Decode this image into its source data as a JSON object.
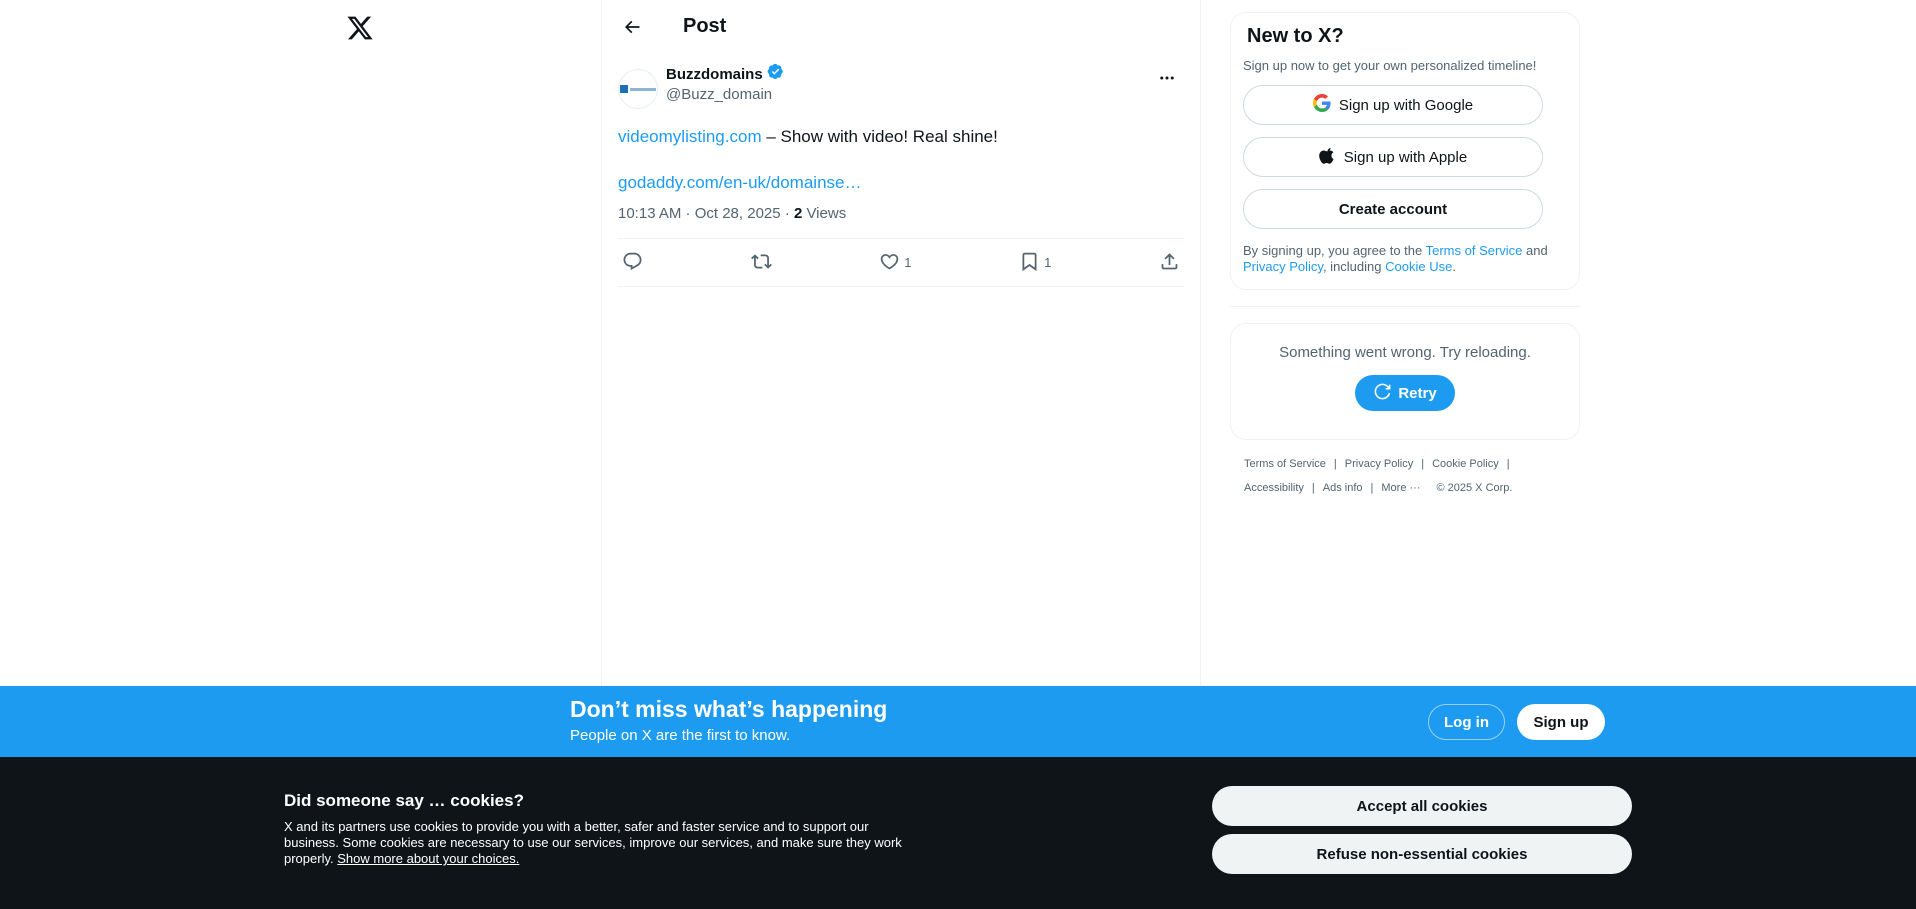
{
  "topbar": {
    "title": "Post"
  },
  "post": {
    "display_name": "Buzzdomains",
    "handle": "@Buzz_domain",
    "text_link": "videomylisting.com",
    "text_rest": " – Show with video! Real shine!",
    "link2": "godaddy.com/en-uk/domainse…",
    "time": "10:13 AM · Oct 28, 2025 · ",
    "views_count": "2",
    "views_label": " Views",
    "likes": "1",
    "bookmarks": "1"
  },
  "signup_card": {
    "title": "New to X?",
    "subtitle": "Sign up now to get your own personalized timeline!",
    "google": "Sign up with Google",
    "apple": "Sign up with Apple",
    "create": "Create account",
    "terms_prefix": "By signing up, you agree to the ",
    "terms_link": "Terms of Service",
    "terms_and": " and ",
    "privacy_link": "Privacy Policy",
    "including": ", including ",
    "cookie_link": "Cookie Use",
    "period": "."
  },
  "error_card": {
    "message": "Something went wrong. Try reloading.",
    "retry": "Retry"
  },
  "footer": {
    "terms": "Terms of Service",
    "privacy": "Privacy Policy",
    "cookie": "Cookie Policy",
    "accessibility": "Accessibility",
    "ads": "Ads info",
    "more": "More ···",
    "copyright": "© 2025 X Corp."
  },
  "banner": {
    "title": "Don’t miss what’s happening",
    "subtitle": "People on X are the first to know.",
    "login": "Log in",
    "signup": "Sign up"
  },
  "cookies": {
    "title": "Did someone say … cookies?",
    "text": "X and its partners use cookies to provide you with a better, safer and faster service and to support our business. Some cookies are necessary to use our services, improve our services, and make sure they work properly. ",
    "link": "Show more about your choices.",
    "accept": "Accept all cookies",
    "refuse": "Refuse non-essential cookies"
  },
  "colors": {
    "accent": "#1d9bf0",
    "dark": "#0f1419",
    "muted": "#536471"
  }
}
